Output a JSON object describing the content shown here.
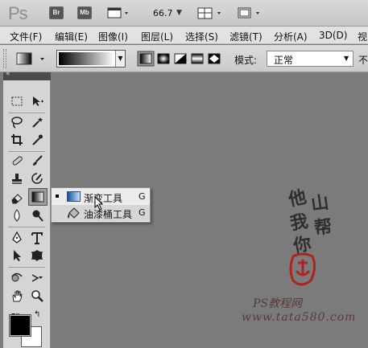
{
  "app": {
    "logo": "Ps",
    "bridge_label": "Br",
    "minibridge_label": "Mb",
    "zoom": "66.7"
  },
  "menu": [
    "文件(F)",
    "编辑(E)",
    "图像(I)",
    "图层(L)",
    "选择(S)",
    "滤镜(T)",
    "分析(A)",
    "3D(D)",
    "视"
  ],
  "options": {
    "mode_label": "模式:",
    "mode_value": "正常",
    "opacity_label_partial": "不"
  },
  "flyout": {
    "items": [
      {
        "label": "渐变工具",
        "shortcut": "G",
        "active": true
      },
      {
        "label": "油漆桶工具",
        "shortcut": "G",
        "active": false
      }
    ]
  },
  "colors": {
    "foreground": "#000000",
    "background": "#ffffff",
    "canvas": "#7b7b7b"
  },
  "watermark": {
    "line1": "他",
    "line2": "山",
    "line3": "我",
    "line4": "帮",
    "line5": "你",
    "site_cn": "PS教程网",
    "site_url": "www.tata580.com"
  }
}
